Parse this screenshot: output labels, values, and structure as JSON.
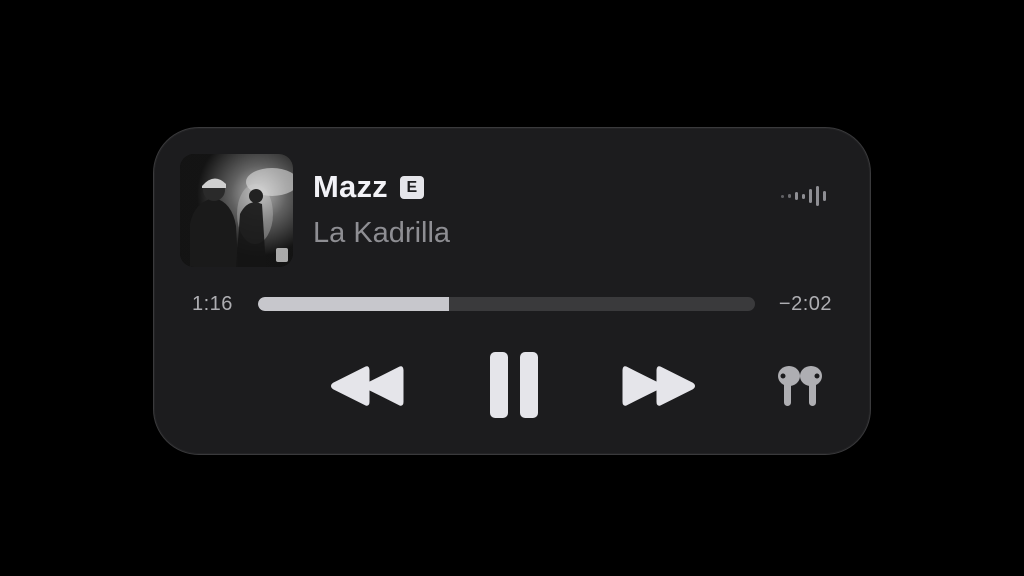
{
  "now_playing": {
    "title": "Mazz",
    "explicit_badge": "E",
    "artist": "La Kadrilla",
    "artwork_icon": "album-artwork",
    "waveform_icon": "waveform-icon"
  },
  "playback": {
    "elapsed": "1:16",
    "remaining": "−2:02",
    "progress_fraction": 0.385
  },
  "controls": {
    "rewind_icon": "rewind-icon",
    "pause_icon": "pause-icon",
    "forward_icon": "fast-forward-icon",
    "output_icon": "airpods-icon"
  },
  "colors": {
    "background": "#000000",
    "panel": "#1c1c1e",
    "primary_text": "#f2f2f7",
    "secondary_text": "#8e8e93",
    "progress_fill": "#c7c7cc",
    "progress_track": "#3a3a3c"
  }
}
